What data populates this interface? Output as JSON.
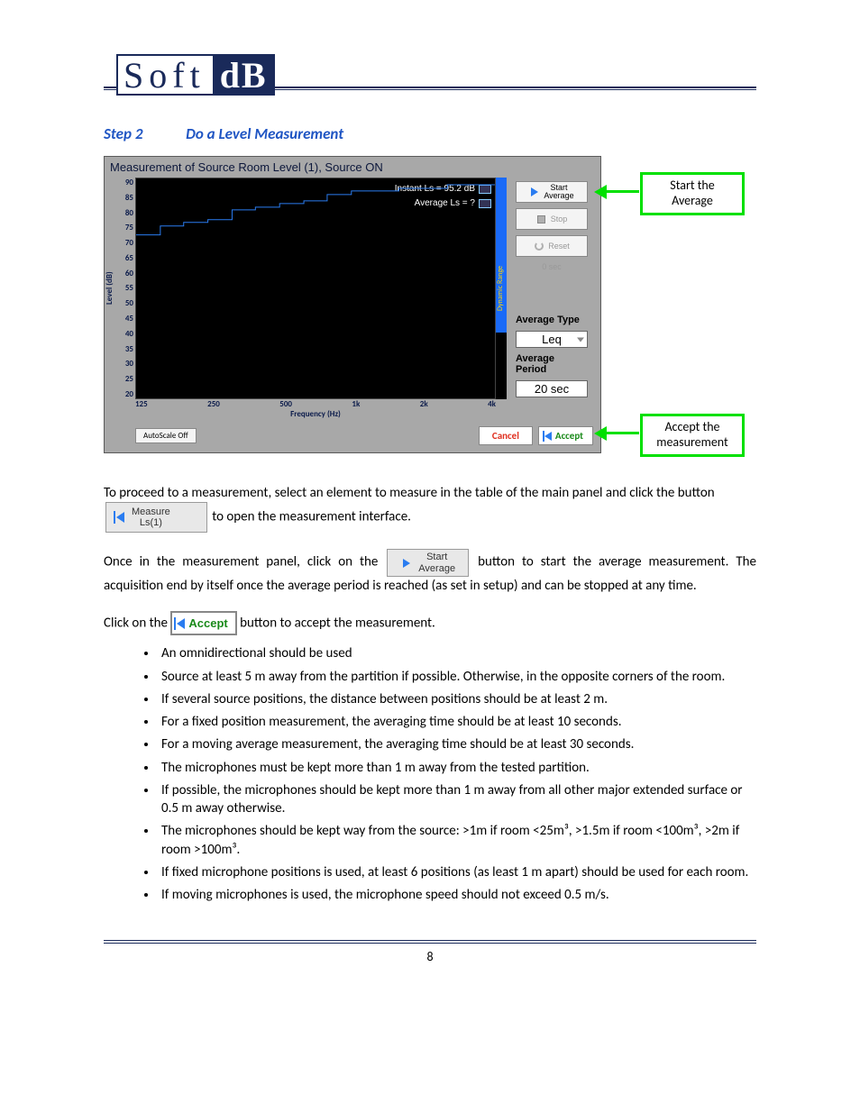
{
  "brand": {
    "part1": "Soft",
    "part2": "dB"
  },
  "heading": {
    "step": "Step 2",
    "title": "Do a Level Measurement"
  },
  "screenshot": {
    "title": "Measurement of Source Room Level (1), Source ON",
    "legend_instant": "Instant Ls  =   95.2 dB",
    "legend_average": "Average Ls  =  ?",
    "ylabel": "Level (dB)",
    "xlabel": "Frequency (Hz)",
    "yticks": [
      "90",
      "85",
      "80",
      "75",
      "70",
      "65",
      "60",
      "55",
      "50",
      "45",
      "40",
      "35",
      "30",
      "25",
      "20"
    ],
    "xticks": [
      "125",
      "250",
      "500",
      "1k",
      "2k",
      "4k"
    ],
    "dynrange": "Dynamic Range",
    "side": {
      "start_l1": "Start",
      "start_l2": "Average",
      "stop": "Stop",
      "reset": "Reset",
      "time": "0 sec",
      "avgtype_label": "Average Type",
      "avgtype_value": "Leq",
      "avgperiod_label": "Average Period",
      "avgperiod_value": "20 sec"
    },
    "autoscale": "AutoScale Off",
    "cancel": "Cancel",
    "accept": "Accept"
  },
  "callouts": {
    "start": "Start the Average",
    "accept": "Accept the measurement"
  },
  "paragraphs": {
    "p1_a": "To proceed to a measurement, select an element to measure in the table of the main panel and click the button ",
    "p1_b": " to open the measurement interface.",
    "measure_btn_l1": "Measure",
    "measure_btn_l2": "Ls(1)",
    "p2_a": "Once in the measurement panel, click on the ",
    "p2_b": " button to start the average measurement. The acquisition end by itself once the average period is reached (as set in setup) and can be stopped at any time.",
    "start_btn_l1": "Start",
    "start_btn_l2": "Average",
    "p3_a": "Click on the ",
    "p3_b": " button to accept the measurement.",
    "accept_btn": "Accept"
  },
  "bullets": [
    "An omnidirectional should be used",
    "Source at least 5 m away from the partition if possible. Otherwise, in the opposite corners of the room.",
    "If several source positions, the distance between positions should be at least 2 m.",
    "For a fixed position measurement, the averaging time should be at least 10 seconds.",
    "For a moving average measurement, the averaging time should be at least 30 seconds.",
    "The microphones must be kept more than 1 m away from the tested partition.",
    "If possible, the microphones should be kept more than 1 m away from all other major extended surface or 0.5 m away otherwise.",
    "The microphones should be kept way from the source: >1m if room <25m³, >1.5m if room <100m³, >2m if room >100m³.",
    "If fixed microphone positions is used, at least 6 positions (as least 1 m apart) should be used for each room.",
    "If moving microphones is used, the microphone speed should not exceed 0.5 m/s."
  ],
  "chart_data": {
    "type": "line",
    "title": "Measurement of Source Room Level (1), Source ON",
    "xlabel": "Frequency (Hz)",
    "ylabel": "Level (dB)",
    "xlim": [
      125,
      4000
    ],
    "ylim": [
      20,
      90
    ],
    "x_scale": "log",
    "series": [
      {
        "name": "Instant Ls",
        "x": [
          125,
          160,
          200,
          250,
          315,
          400,
          500,
          630,
          800,
          1000,
          1250,
          1600,
          2000,
          2500,
          3150,
          4000
        ],
        "y": [
          72,
          75,
          76,
          77,
          80,
          81,
          82,
          83,
          85,
          86,
          86,
          87,
          87,
          88,
          88,
          88
        ]
      }
    ],
    "annotations": {
      "Instant Ls": "95.2 dB",
      "Average Ls": "?"
    }
  },
  "page_number": "8"
}
